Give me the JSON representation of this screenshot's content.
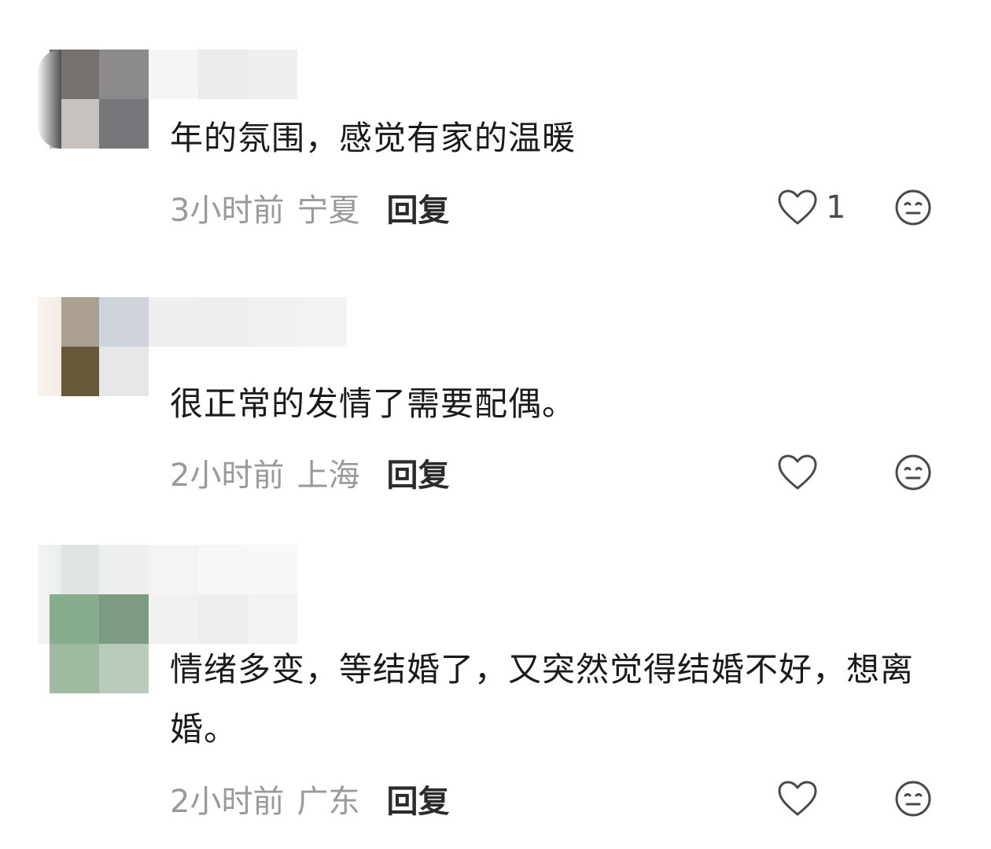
{
  "comments": [
    {
      "username": "",
      "content": "年的氛围，感觉有家的温暖",
      "time": "3小时前",
      "region": "宁夏",
      "reply_label": "回复",
      "like_count": "1"
    },
    {
      "username": "",
      "content": "很正常的发情了需要配偶。",
      "time": "2小时前",
      "region": "上海",
      "reply_label": "回复",
      "like_count": ""
    },
    {
      "username": "",
      "content": "情绪多变，等结婚了，又突然觉得结婚不好，想离婚。",
      "time": "2小时前",
      "region": "广东",
      "reply_label": "回复",
      "like_count": ""
    }
  ],
  "icons": {
    "like": "heart-outline-icon",
    "emoji": "neutral-face-icon"
  },
  "colors": {
    "text_primary": "#1a1a1a",
    "text_secondary": "#9a9a9a",
    "reply": "#2b2b2b",
    "icon": "#4a4a4a"
  }
}
